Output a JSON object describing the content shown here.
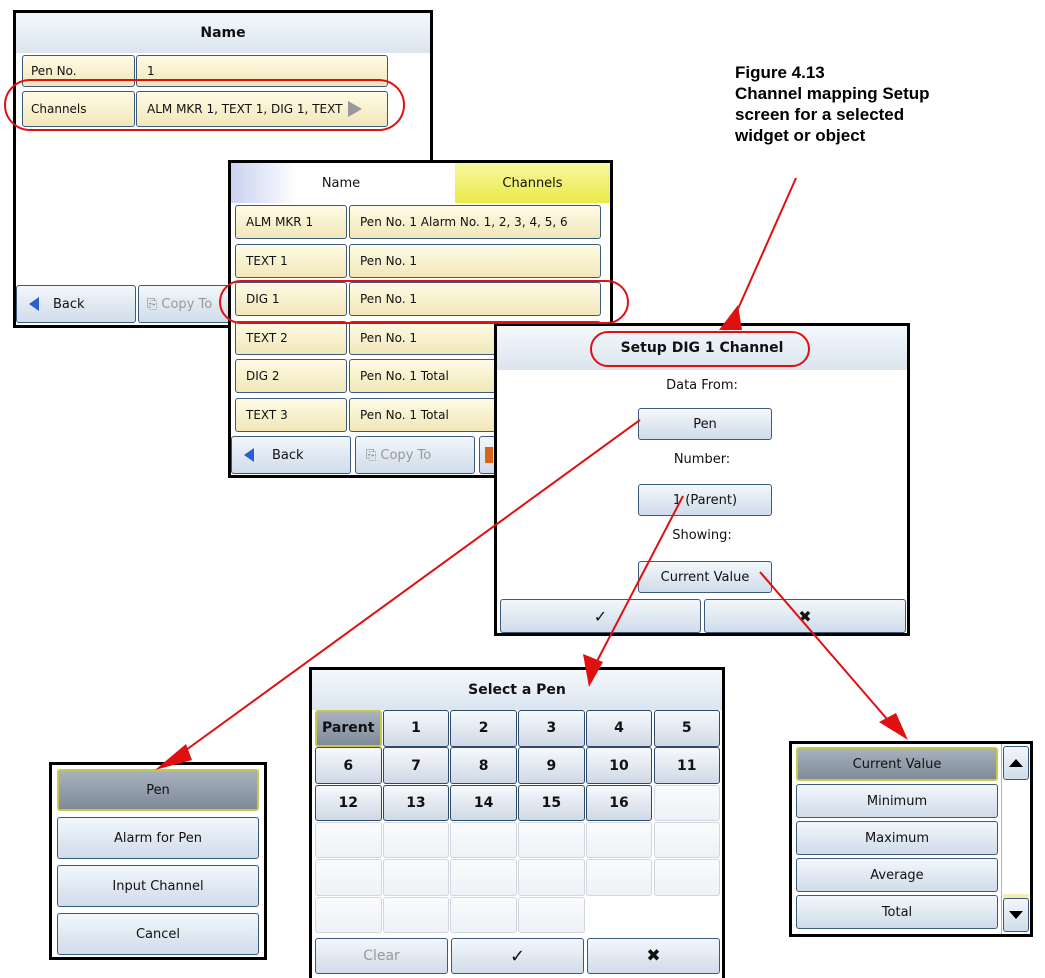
{
  "figure": {
    "caption_line1": "Figure 4.13",
    "caption_line2": "Channel mapping Setup",
    "caption_line3": "screen for a selected",
    "caption_line4": "widget or object"
  },
  "name_screen": {
    "title": "Name",
    "rows": [
      {
        "label": "Pen No.",
        "value": "1"
      },
      {
        "label": "Channels",
        "value": "ALM MKR 1, TEXT 1, DIG 1, TEXT"
      }
    ],
    "back_label": "Back",
    "copy_label": "Copy To"
  },
  "channels_screen": {
    "crumb_name": "Name",
    "crumb_channels": "Channels",
    "rows": [
      {
        "label": "ALM MKR 1",
        "value": "Pen No. 1 Alarm No.  1, 2, 3, 4, 5, 6"
      },
      {
        "label": "TEXT 1",
        "value": "Pen No. 1"
      },
      {
        "label": "DIG 1",
        "value": "Pen No. 1"
      },
      {
        "label": "TEXT 2",
        "value": "Pen No. 1"
      },
      {
        "label": "DIG 2",
        "value": "Pen No. 1 Total"
      },
      {
        "label": "TEXT 3",
        "value": "Pen No. 1 Total"
      }
    ],
    "back_label": "Back",
    "copy_label": "Copy To"
  },
  "setup_screen": {
    "title": "Setup DIG 1 Channel",
    "data_from_label": "Data From:",
    "data_from_value": "Pen",
    "number_label": "Number:",
    "number_value": "1 (Parent)",
    "showing_label": "Showing:",
    "showing_value": "Current Value",
    "ok_glyph": "✓",
    "cancel_glyph": "✖"
  },
  "pen_source_list": {
    "items": [
      "Pen",
      "Alarm for Pen",
      "Input Channel",
      "Cancel"
    ],
    "selected": "Pen"
  },
  "pen_select": {
    "title": "Select a Pen",
    "keys": [
      "Parent",
      "1",
      "2",
      "3",
      "4",
      "5",
      "6",
      "7",
      "8",
      "9",
      "10",
      "11",
      "12",
      "13",
      "14",
      "15",
      "16"
    ],
    "selected": "Parent",
    "clear_label": "Clear",
    "ok_glyph": "✓",
    "cancel_glyph": "✖"
  },
  "showing_list": {
    "items": [
      "Current Value",
      "Minimum",
      "Maximum",
      "Average",
      "Total"
    ],
    "selected": "Current Value"
  },
  "colors": {
    "annotation": "#e01010",
    "crumb_active": "#f0f060",
    "selected_fill": "#8c96a3"
  }
}
